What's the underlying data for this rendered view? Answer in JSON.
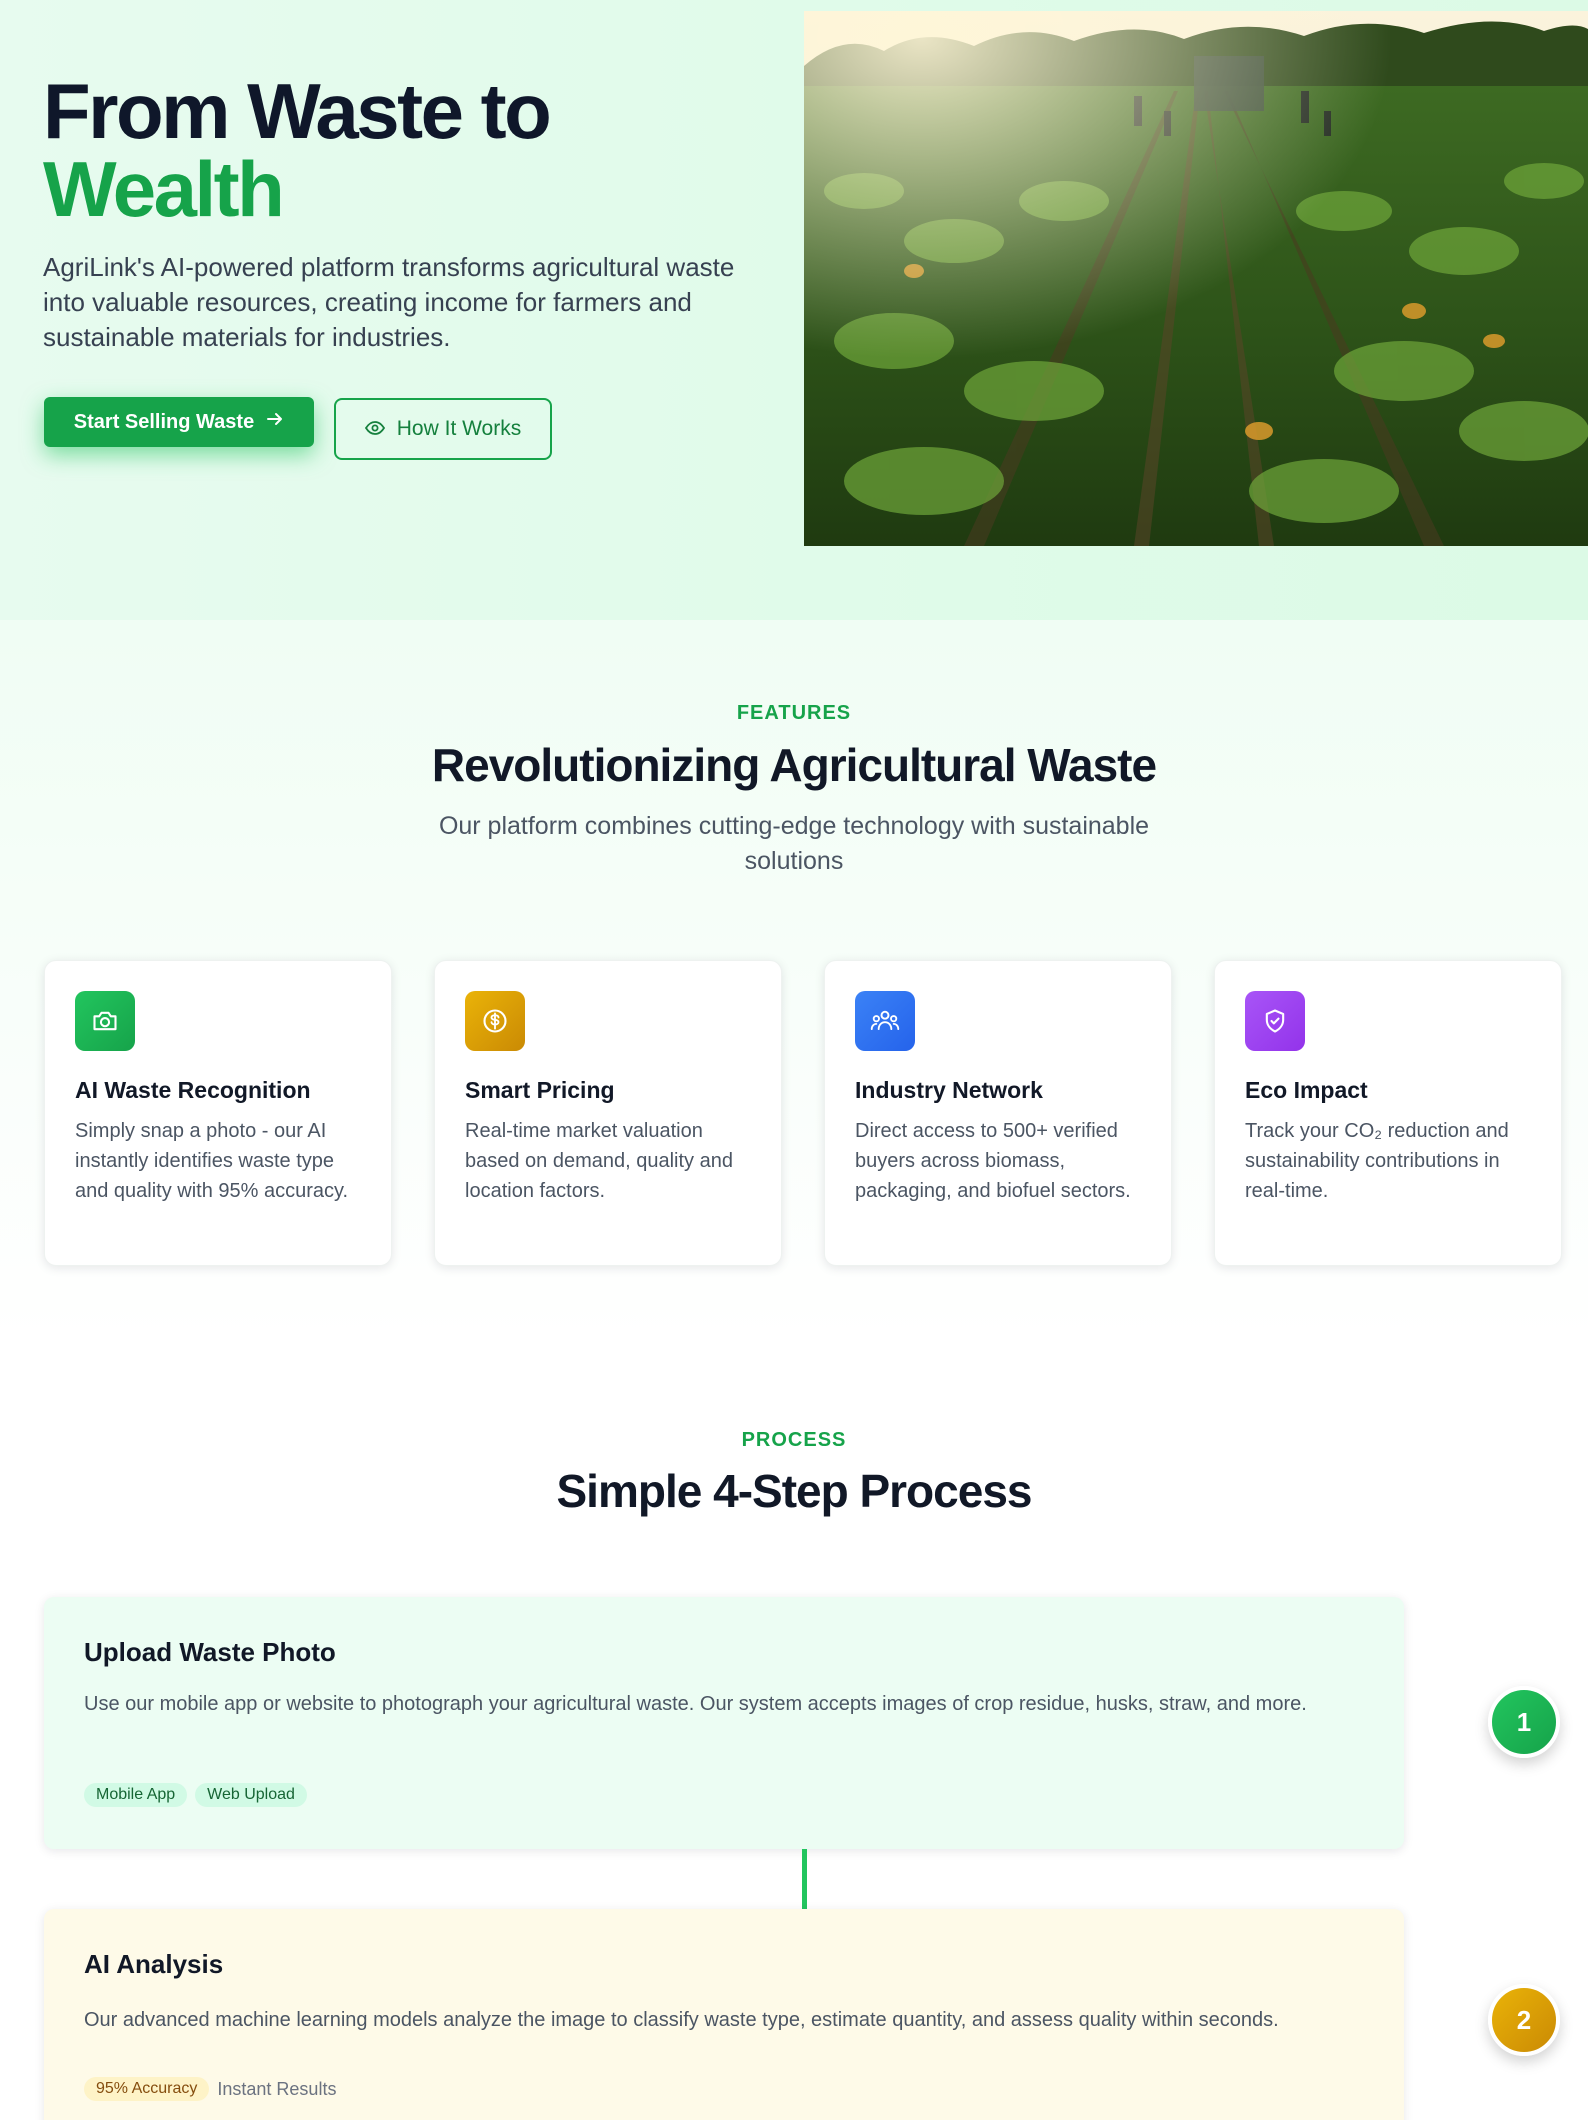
{
  "hero": {
    "title_line1": "From Waste to",
    "title_line2": "Wealth",
    "subtitle": "AgriLink's AI-powered platform transforms agricultural waste into valuable resources, creating income for farmers and sustainable materials for industries.",
    "primary_cta": "Start Selling Waste",
    "secondary_cta": "How It Works"
  },
  "features": {
    "eyebrow": "FEATURES",
    "title": "Revolutionizing Agricultural Waste",
    "subtitle": "Our platform combines cutting-edge technology with sustainable solutions",
    "cards": [
      {
        "icon": "camera-icon",
        "color": "#22c55e",
        "title": "AI Waste Recognition",
        "desc": "Simply snap a photo - our AI instantly identifies waste type and quality with 95% accuracy."
      },
      {
        "icon": "dollar-icon",
        "color": "#eab308",
        "title": "Smart Pricing",
        "desc": "Real-time market valuation based on demand, quality and location factors."
      },
      {
        "icon": "users-icon",
        "color": "#3b82f6",
        "title": "Industry Network",
        "desc": "Direct access to 500+ verified buyers across biomass, packaging, and biofuel sectors."
      },
      {
        "icon": "shield-icon",
        "color": "#a855f7",
        "title": "Eco Impact",
        "desc": "Track your CO₂ reduction and sustainability contributions in real-time."
      }
    ]
  },
  "process": {
    "eyebrow": "PROCESS",
    "title": "Simple 4-Step Process",
    "steps": [
      {
        "number": "1",
        "title": "Upload Waste Photo",
        "desc": "Use our mobile app or website to photograph your agricultural waste. Our system accepts images of crop residue, husks, straw, and more.",
        "tags": [
          "Mobile App",
          "Web Upload"
        ]
      },
      {
        "number": "2",
        "title": "AI Analysis",
        "desc": "Our advanced machine learning models analyze the image to classify waste type, estimate quantity, and assess quality within seconds.",
        "tags": [
          "95% Accuracy"
        ],
        "note": "Instant Results"
      }
    ]
  }
}
